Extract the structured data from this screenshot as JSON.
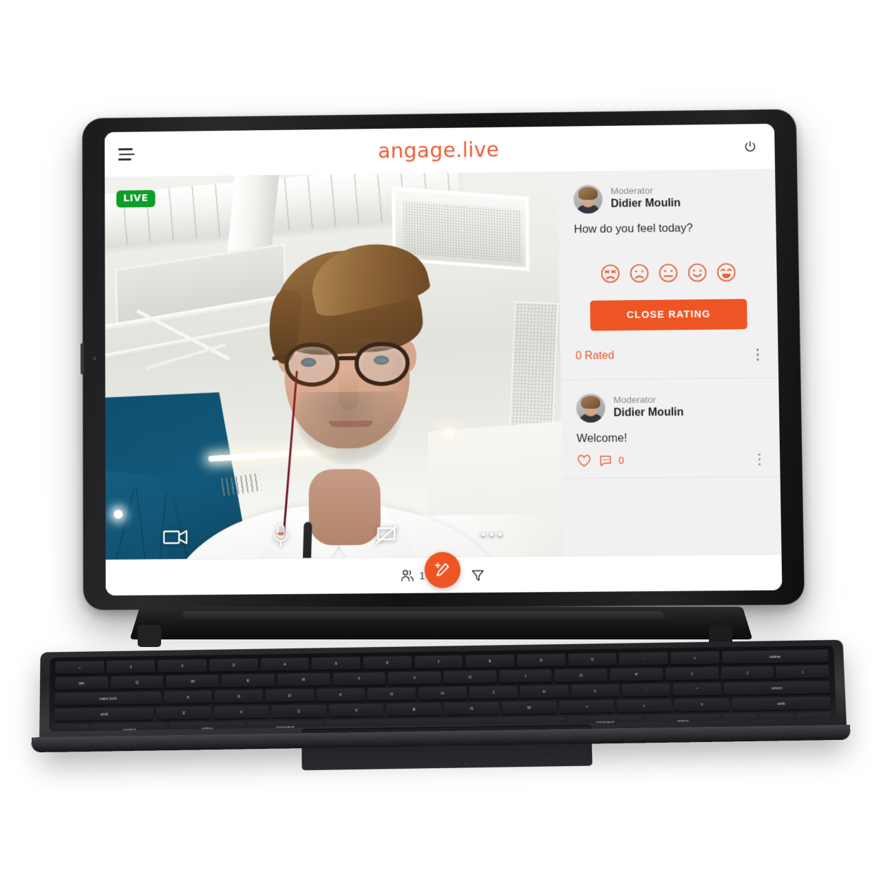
{
  "app": {
    "brand": "angage.live",
    "menu_icon": "hamburger-menu-icon",
    "power_icon": "power-icon"
  },
  "video": {
    "live_badge": "LIVE",
    "controls": [
      {
        "name": "camera-toggle-button",
        "icon": "video-camera-icon"
      },
      {
        "name": "microphone-toggle-button",
        "icon": "microphone-icon"
      },
      {
        "name": "screenshare-toggle-button",
        "icon": "screen-share-off-icon"
      },
      {
        "name": "more-options-button",
        "icon": "ellipsis-icon"
      }
    ]
  },
  "sidebar": {
    "rating_post": {
      "role": "Moderator",
      "author": "Didier Moulin",
      "question": "How do you feel today?",
      "emojis": [
        {
          "name": "emoji-angry",
          "label": "angry"
        },
        {
          "name": "emoji-sad",
          "label": "sad"
        },
        {
          "name": "emoji-neutral",
          "label": "neutral"
        },
        {
          "name": "emoji-smile",
          "label": "smile"
        },
        {
          "name": "emoji-laugh",
          "label": "laughing"
        }
      ],
      "close_button": "CLOSE RATING",
      "rated_status": "0 Rated"
    },
    "message_post": {
      "role": "Moderator",
      "author": "Didier Moulin",
      "text": "Welcome!",
      "like_icon": "heart-icon",
      "comment_icon": "comment-bubble-icon",
      "comment_count": "0"
    }
  },
  "footer": {
    "participants_icon": "people-icon",
    "participants_count": "1",
    "compose_icon": "compose-pencil-icon",
    "filter_icon": "filter-funnel-icon"
  },
  "keyboard": {
    "rows": [
      [
        "~",
        "1",
        "2",
        "3",
        "4",
        "5",
        "6",
        "7",
        "8",
        "9",
        "0",
        "-",
        "+",
        "delete"
      ],
      [
        "tab",
        "Q",
        "W",
        "E",
        "R",
        "T",
        "Y",
        "U",
        "I",
        "O",
        "P",
        "{",
        "}",
        "|"
      ],
      [
        "caps lock",
        "A",
        "S",
        "D",
        "F",
        "G",
        "H",
        "J",
        "K",
        "L",
        ":",
        "\"",
        "return"
      ],
      [
        "shift",
        "Z",
        "X",
        "C",
        "V",
        "B",
        "N",
        "M",
        "<",
        ">",
        "?",
        "shift"
      ],
      [
        "",
        "control",
        "option",
        "command",
        "",
        "command",
        "option",
        "",
        "",
        ""
      ]
    ]
  },
  "colors": {
    "brand_orange": "#EE5524",
    "live_green": "#0D9E28",
    "sidebar_bg": "#F1F1F1"
  }
}
